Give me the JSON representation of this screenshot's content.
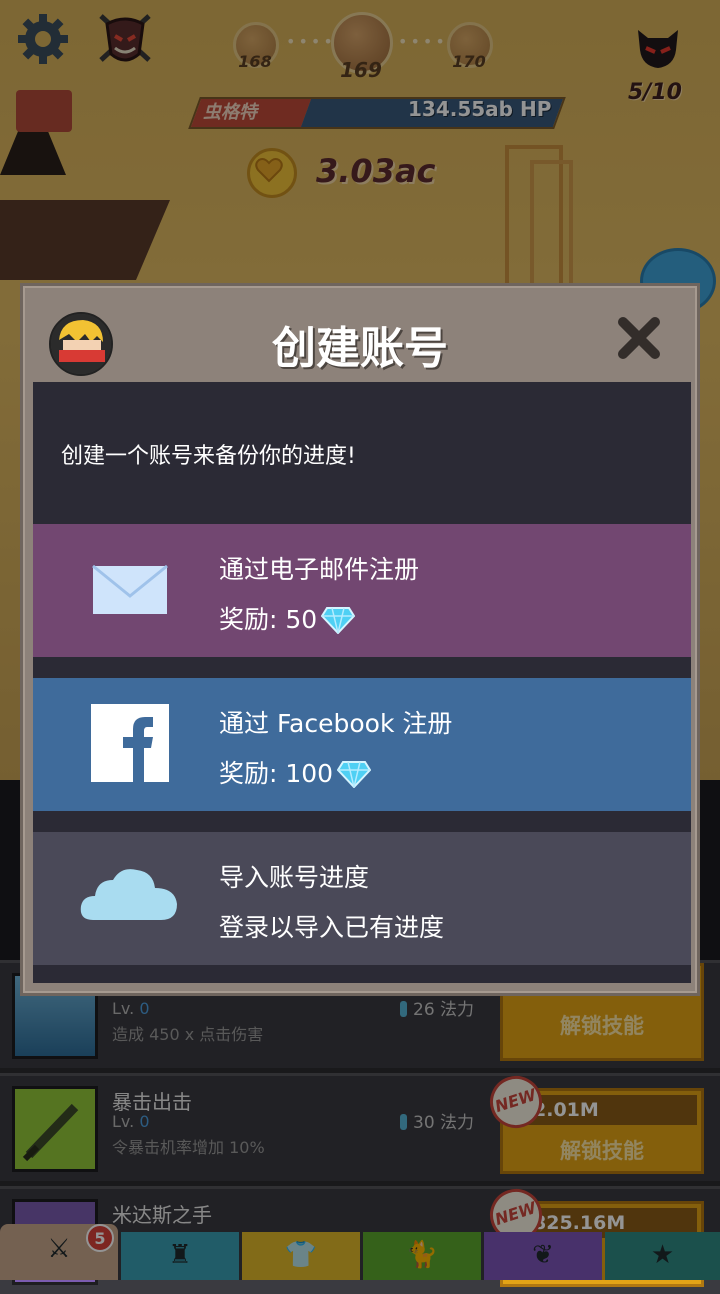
{
  "hud": {
    "stages": [
      "168",
      "169",
      "170"
    ],
    "kills": "5/10",
    "boss_name": "虫格特",
    "boss_hp": "134.55ab HP",
    "gold": "3.03ac"
  },
  "modal": {
    "title": "创建账号",
    "intro": "创建一个账号来备份你的进度!",
    "email": {
      "title": "通过电子邮件注册",
      "reward": "奖励: 50"
    },
    "facebook": {
      "title": "通过 Facebook 注册",
      "reward": "奖励: 100"
    },
    "import": {
      "title": "导入账号进度",
      "subtitle": "登录以导入已有进度"
    }
  },
  "skills": [
    {
      "name": "",
      "level_label": "Lv.",
      "level": "0",
      "desc": "造成 450 x 点击伤害",
      "mana": "26 法力",
      "price": "",
      "action": "解锁技能"
    },
    {
      "name": "暴击出击",
      "level_label": "Lv.",
      "level": "0",
      "desc": "令暴击机率增加 10%",
      "mana": "30 法力",
      "price": "2.01M",
      "action": "解锁技能",
      "badge": "NEW"
    },
    {
      "name": "米达斯之手",
      "price": "825.16M",
      "badge": "NEW"
    }
  ],
  "tabs": {
    "sword_badge": "5"
  },
  "colors": {
    "email_bg": "#724771",
    "facebook_bg": "#3f6b9b",
    "import_bg": "#4a4958",
    "modal_frame": "#8d827a",
    "unlock_button": "#e3a416"
  },
  "icons": [
    "gear-icon",
    "demon-emblem-icon",
    "skull-icon",
    "heart-coin-icon",
    "mail-icon",
    "facebook-icon",
    "cloud-icon",
    "close-icon",
    "gem-icon",
    "sword-icon",
    "helmet-icon",
    "shirt-icon",
    "cat-icon",
    "dragon-icon",
    "star-icon"
  ]
}
